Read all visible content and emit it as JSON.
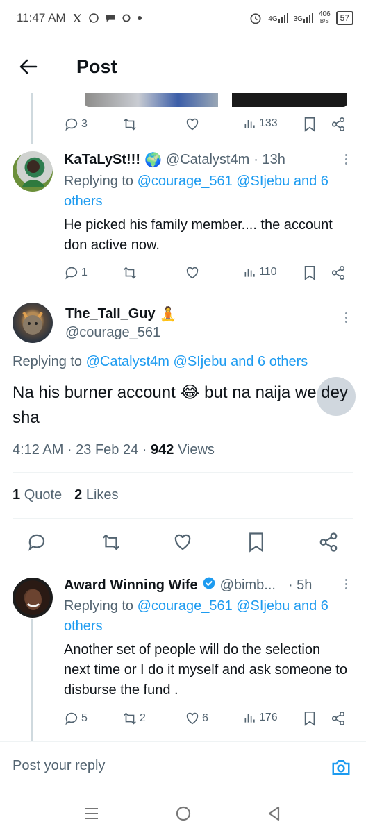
{
  "status_bar": {
    "time": "11:47 AM",
    "left_icons": [
      "x-logo-icon",
      "whatsapp-icon",
      "chat-bubble-icon",
      "circle-icon",
      "dot-icon"
    ],
    "network_1": "4G",
    "network_2": "3G",
    "net_speed_value": "406",
    "net_speed_unit": "B/S",
    "battery": "57"
  },
  "header": {
    "title": "Post"
  },
  "top_tweet_actions": {
    "replies": "3",
    "retweets": "",
    "likes": "",
    "views": "133"
  },
  "reply1": {
    "name": "KaTaLySt!!!",
    "name_emoji": "🌍",
    "handle": "@Catalyst4m",
    "time": "· 13h",
    "replying_prefix": "Replying to",
    "replying_mentions": "@courage_561 @SIjebu and 6 others",
    "text": "He picked his family member.... the account don active now.",
    "replies": "1",
    "views": "110"
  },
  "main_tweet": {
    "name": "The_Tall_Guy",
    "name_emoji": "🧘",
    "handle": "@courage_561",
    "replying_prefix": "Replying to",
    "replying_mentions": "@Catalyst4m @SIjebu and 6 others",
    "text": "Na his burner account 😂 but na naija we dey sha",
    "timestamp": "4:12 AM · 23 Feb 24 ·",
    "views_count": "942",
    "views_label": "Views",
    "quotes_count": "1",
    "quotes_label": "Quote",
    "likes_count": "2",
    "likes_label": "Likes"
  },
  "reply2": {
    "name": "Award Winning Wife",
    "handle": "@bimb...",
    "time": "· 5h",
    "replying_prefix": "Replying to",
    "replying_mentions": "@courage_561 @SIjebu and 6 others",
    "text": "Another set of people will do the selection next time or I do it myself and ask someone to disburse the fund .",
    "replies": "5",
    "retweets": "2",
    "likes": "6",
    "views": "176"
  },
  "composer": {
    "placeholder": "Post your reply"
  },
  "colors": {
    "accent": "#1d9bf0",
    "text_primary": "#0f1419",
    "text_secondary": "#536471",
    "divider": "#eff3f4"
  }
}
